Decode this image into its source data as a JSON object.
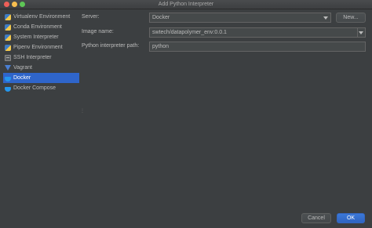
{
  "window": {
    "title": "Add Python Interpreter"
  },
  "sidebar": {
    "items": [
      {
        "label": "Virtualenv Environment",
        "icon": "python-icon",
        "selected": false
      },
      {
        "label": "Conda Environment",
        "icon": "python-icon",
        "selected": false
      },
      {
        "label": "System Interpreter",
        "icon": "python-icon",
        "selected": false
      },
      {
        "label": "Pipenv Environment",
        "icon": "python-icon",
        "selected": false
      },
      {
        "label": "SSH Interpreter",
        "icon": "ssh-icon",
        "selected": false
      },
      {
        "label": "Vagrant",
        "icon": "vagrant-icon",
        "selected": false
      },
      {
        "label": "Docker",
        "icon": "docker-icon",
        "selected": true
      },
      {
        "label": "Docker Compose",
        "icon": "docker-icon",
        "selected": false
      }
    ]
  },
  "form": {
    "server_label": "Server:",
    "server_value": "Docker",
    "new_button": "New...",
    "image_label": "Image name:",
    "image_value": "swtech/datapolymer_env:0.0.1",
    "path_label": "Python interpreter path:",
    "path_value": "python"
  },
  "footer": {
    "cancel_label": "Cancel",
    "ok_label": "OK"
  },
  "colors": {
    "background": "#3c3f41",
    "selection": "#2f65ca",
    "primary_button": "#3574d4"
  }
}
